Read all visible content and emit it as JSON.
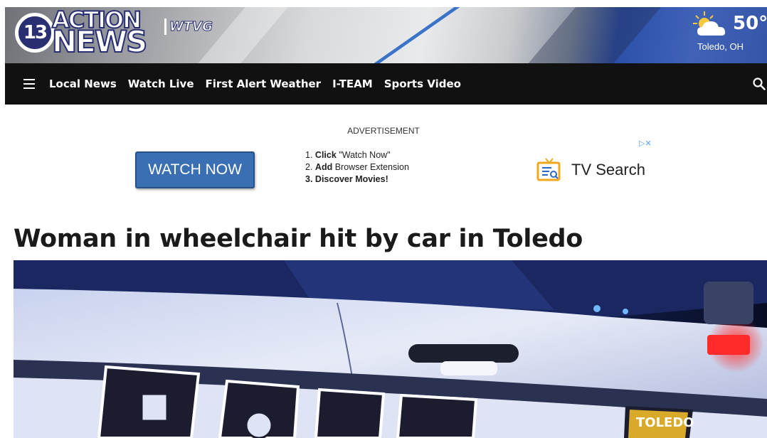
{
  "header": {
    "logo": {
      "number": "13",
      "line1": "ACTION",
      "line2": "NEWS",
      "callsign": "WTVG"
    },
    "weather": {
      "icon": "partly-cloudy-icon",
      "temperature": "50°",
      "location": "Toledo, OH"
    }
  },
  "nav": {
    "menu_icon": "hamburger-menu-icon",
    "items": [
      {
        "label": "Local News"
      },
      {
        "label": "Watch Live"
      },
      {
        "label": "First Alert Weather"
      },
      {
        "label": "I-TEAM"
      },
      {
        "label": "Sports Video"
      }
    ],
    "search_icon": "search-icon"
  },
  "ad": {
    "label": "ADVERTISEMENT",
    "button": "WATCH NOW",
    "steps": [
      {
        "num": "1.",
        "bold": "Click",
        "rest": "\"Watch Now\""
      },
      {
        "num": "2.",
        "bold": "Add",
        "rest": "Browser Extension"
      },
      {
        "num": "3.",
        "bold": "Discover Movies!",
        "rest": ""
      }
    ],
    "brand": "TV Search",
    "badge": "▷✕"
  },
  "article": {
    "headline": "Woman in wheelchair hit by car in Toledo"
  },
  "colors": {
    "nav_bg": "#111111",
    "ad_button": "#3a6fb4",
    "logo_navy": "#2a2f74"
  }
}
